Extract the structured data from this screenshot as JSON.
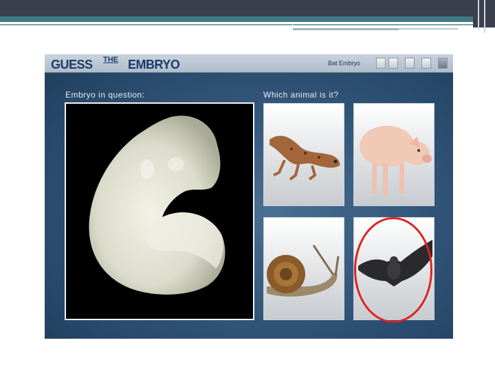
{
  "app": {
    "logo": {
      "part1": "GUESS",
      "part2": "THE",
      "part3": "EMBRYO"
    },
    "answer_display": "Bat Embryo",
    "window_buttons": [
      "minimize",
      "option-2",
      "option-3",
      "option-4",
      "close"
    ]
  },
  "labels": {
    "embryo_in_question": "Embryo in question:",
    "which_animal": "Which animal is it?"
  },
  "choices": [
    {
      "animal": "gecko",
      "selected": false
    },
    {
      "animal": "pig",
      "selected": false
    },
    {
      "animal": "snail",
      "selected": false
    },
    {
      "animal": "bat",
      "selected": true
    }
  ],
  "colors": {
    "selection_ring": "#e0201e",
    "header_text": "#1d3a66",
    "app_background": "#2f5275"
  }
}
